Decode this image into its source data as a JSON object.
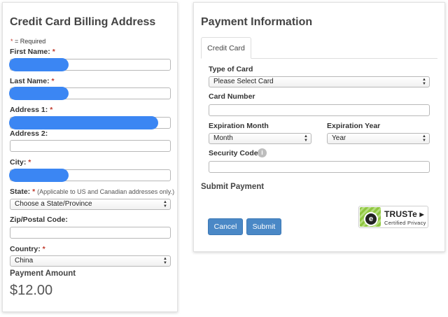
{
  "billing": {
    "title": "Credit Card Billing Address",
    "required_note": "= Required",
    "required_star": "*",
    "fields": {
      "first_name": {
        "label": "First Name:",
        "required": "*",
        "value": ""
      },
      "last_name": {
        "label": "Last Name:",
        "required": "*",
        "value": ""
      },
      "address1": {
        "label": "Address 1:",
        "required": "*",
        "value": ""
      },
      "address2": {
        "label": "Address 2:",
        "value": ""
      },
      "city": {
        "label": "City:",
        "required": "*",
        "value": ""
      },
      "state": {
        "label": "State:",
        "required": "*",
        "note": "(Applicable to US and Canadian addresses only.)",
        "selected": "Choose a State/Province"
      },
      "zip": {
        "label": "Zip/Postal Code:",
        "value": ""
      },
      "country": {
        "label": "Country:",
        "required": "*",
        "selected": "China"
      }
    },
    "payment_amount_label": "Payment Amount",
    "payment_amount": "$12.00"
  },
  "payment": {
    "title": "Payment Information",
    "tab": "Credit Card",
    "type_of_card": {
      "label": "Type of Card",
      "selected": "Please Select Card"
    },
    "card_number": {
      "label": "Card Number",
      "value": ""
    },
    "expiration_month": {
      "label": "Expiration Month",
      "selected": "Month"
    },
    "expiration_year": {
      "label": "Expiration Year",
      "selected": "Year"
    },
    "security_code": {
      "label": "Security Code",
      "info_icon": "i",
      "value": ""
    },
    "submit_title": "Submit Payment",
    "cancel_label": "Cancel",
    "submit_label": "Submit"
  },
  "truste": {
    "icon_letter": "e",
    "brand": "TRUSTe",
    "brand_mark": "▶",
    "subtitle": "Certified Privacy"
  },
  "colors": {
    "redaction": "#3b86f3",
    "button": "#4a88c6",
    "required": "#c0392b",
    "truste_green": "#8fc640"
  },
  "icons": {
    "select_arrows": "updown-arrows-icon",
    "info": "info-icon",
    "truste": "truste-seal-icon"
  },
  "select_arrows": {
    "up": "▲",
    "down": "▼"
  }
}
